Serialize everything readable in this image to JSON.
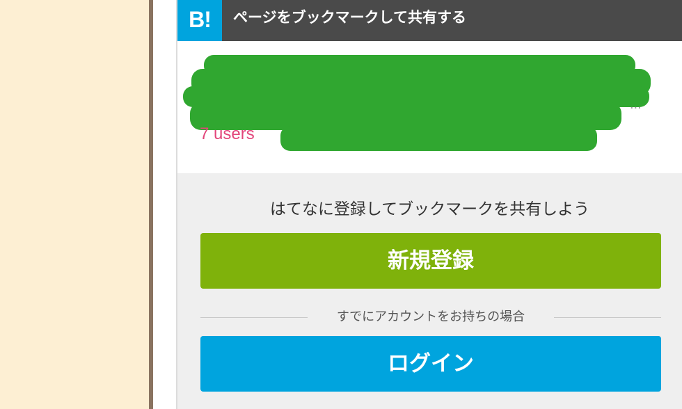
{
  "header": {
    "logo_text": "B!",
    "title": "ページをブックマークして共有する"
  },
  "entry": {
    "title": "[redacted]",
    "users": "7 users",
    "ellipsis": "..."
  },
  "signup": {
    "prompt": "はてなに登録してブックマークを共有しよう",
    "register_label": "新規登録",
    "divider_text": "すでにアカウントをお持ちの場合",
    "login_label": "ログイン"
  },
  "colors": {
    "left_bg": "#fdefd3",
    "left_border": "#8a7360",
    "header_bg": "#4a4a4a",
    "logo_bg": "#00a4de",
    "users_text": "#e2467a",
    "register_button": "#7fb20b",
    "login_button": "#00a4de",
    "redaction": "#1a9e1a"
  }
}
